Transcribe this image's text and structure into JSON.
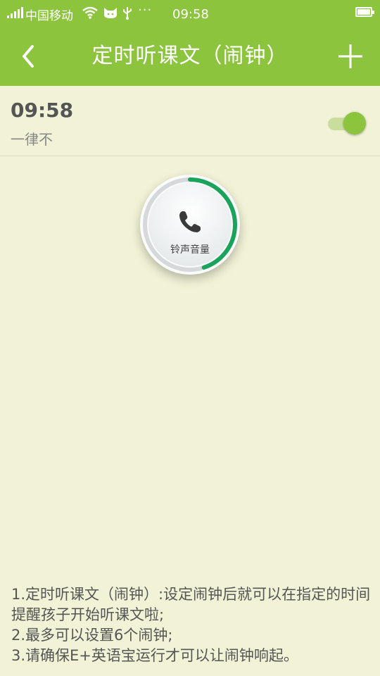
{
  "status_bar": {
    "carrier": "中国移动",
    "more": "···",
    "time": "09:58",
    "icons": [
      "signal-icon",
      "wifi-icon",
      "cat-icon",
      "usb-icon",
      "battery-icon"
    ]
  },
  "header": {
    "title": "定时听课文（闹钟）",
    "back_icon": "chevron-left-icon",
    "add_icon": "plus-icon"
  },
  "alarm": {
    "time": "09:58",
    "repeat": "一律不",
    "enabled": true
  },
  "volume": {
    "label": "铃声音量",
    "icon": "phone-icon",
    "level": 0.45
  },
  "instructions": {
    "line1": "1.定时听课文（闹钟）:设定闹钟后就可以在指定的时间提醒孩子开始听课文啦;",
    "line2": "2.最多可以设置6个闹钟;",
    "line3": "3.请确保E+英语宝运行才可以让闹钟响起。"
  },
  "colors": {
    "accent": "#8cc43e",
    "background": "#f1f2d6",
    "dial_progress": "#1aa35a",
    "text": "#555555"
  }
}
